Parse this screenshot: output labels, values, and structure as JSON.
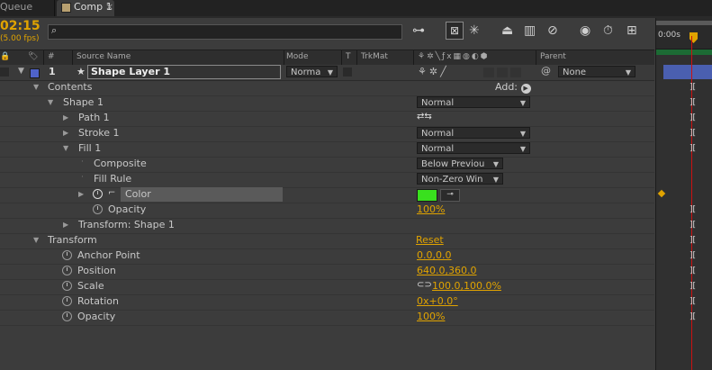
{
  "tabs": {
    "queue": "Queue",
    "comp": "Comp 1",
    "close": "×"
  },
  "timecode": "02:15",
  "fps": "5.00 fps)",
  "search": {
    "placeholder": "",
    "icon": "search-icon"
  },
  "toolbar_icons": [
    "comp-flowchart-icon",
    "draft-3d-icon",
    "solo-icon",
    "frame-blending-icon",
    "motion-blur-icon",
    "graph-editor-icon",
    "brainstorm-icon",
    "stopwatch-icon"
  ],
  "ruler": {
    "start": "0:00s"
  },
  "header": {
    "source_name": "Source Name",
    "mode": "Mode",
    "t": "T",
    "trkmat": "TrkMat",
    "parent": "Parent",
    "hash": "#"
  },
  "layer": {
    "number": "1",
    "name": "Shape Layer 1",
    "mode": "Norma",
    "parent": "None",
    "label_color": "#4f63c9"
  },
  "contents": {
    "label": "Contents",
    "add": "Add:"
  },
  "rows": [
    {
      "name": "Shape 1",
      "mode": "Normal"
    },
    {
      "name": "Path 1"
    },
    {
      "name": "Stroke 1",
      "mode": "Normal"
    },
    {
      "name": "Fill 1",
      "mode": "Normal"
    },
    {
      "name": "Composite",
      "value": "Below Previou"
    },
    {
      "name": "Fill Rule",
      "value": "Non-Zero Win"
    },
    {
      "name": "Color",
      "swatch": "#39e01e"
    },
    {
      "name": "Opacity",
      "value": "100%"
    },
    {
      "name": "Transform: Shape 1"
    }
  ],
  "transform": {
    "label": "Transform",
    "reset": "Reset",
    "props": [
      {
        "name": "Anchor Point",
        "value": "0.0,0.0"
      },
      {
        "name": "Position",
        "value": "640.0,360.0"
      },
      {
        "name": "Scale",
        "value": "100.0,100.0%"
      },
      {
        "name": "Rotation",
        "value": "0x+0.0°"
      },
      {
        "name": "Opacity",
        "value": "100%"
      }
    ]
  },
  "colors": {
    "accent": "#e0a300",
    "bg": "#3c3c3c",
    "playhead": "#cc1111",
    "layer_bar": "#4a5fb0"
  }
}
